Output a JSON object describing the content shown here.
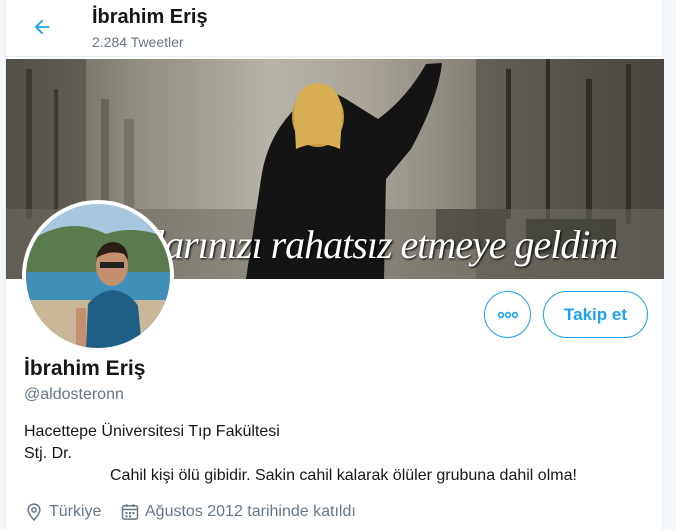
{
  "header": {
    "name": "İbrahim Eriş",
    "tweet_count": "2.284 Tweetler"
  },
  "banner": {
    "caption": "larınızı rahatsız etmeye geldim"
  },
  "profile": {
    "name": "İbrahim Eriş",
    "handle": "@aldosteronn",
    "bio": [
      "Hacettepe Üniversitesi Tıp Fakültesi",
      "Stj. Dr.",
      "Cahil kişi ölü gibidir. Sakin cahil kalarak ölüler grubuna dahil olma!"
    ],
    "location": "Türkiye",
    "joined": "Ağustos 2012 tarihinde katıldı"
  },
  "actions": {
    "follow_label": "Takip et",
    "more_icon": "more-horizontal-icon"
  },
  "icons": {
    "back": "back-arrow-icon",
    "location": "location-pin-icon",
    "calendar": "calendar-icon"
  },
  "colors": {
    "accent": "#1da1f2",
    "secondary_text": "#657786",
    "primary_text": "#14171a"
  }
}
